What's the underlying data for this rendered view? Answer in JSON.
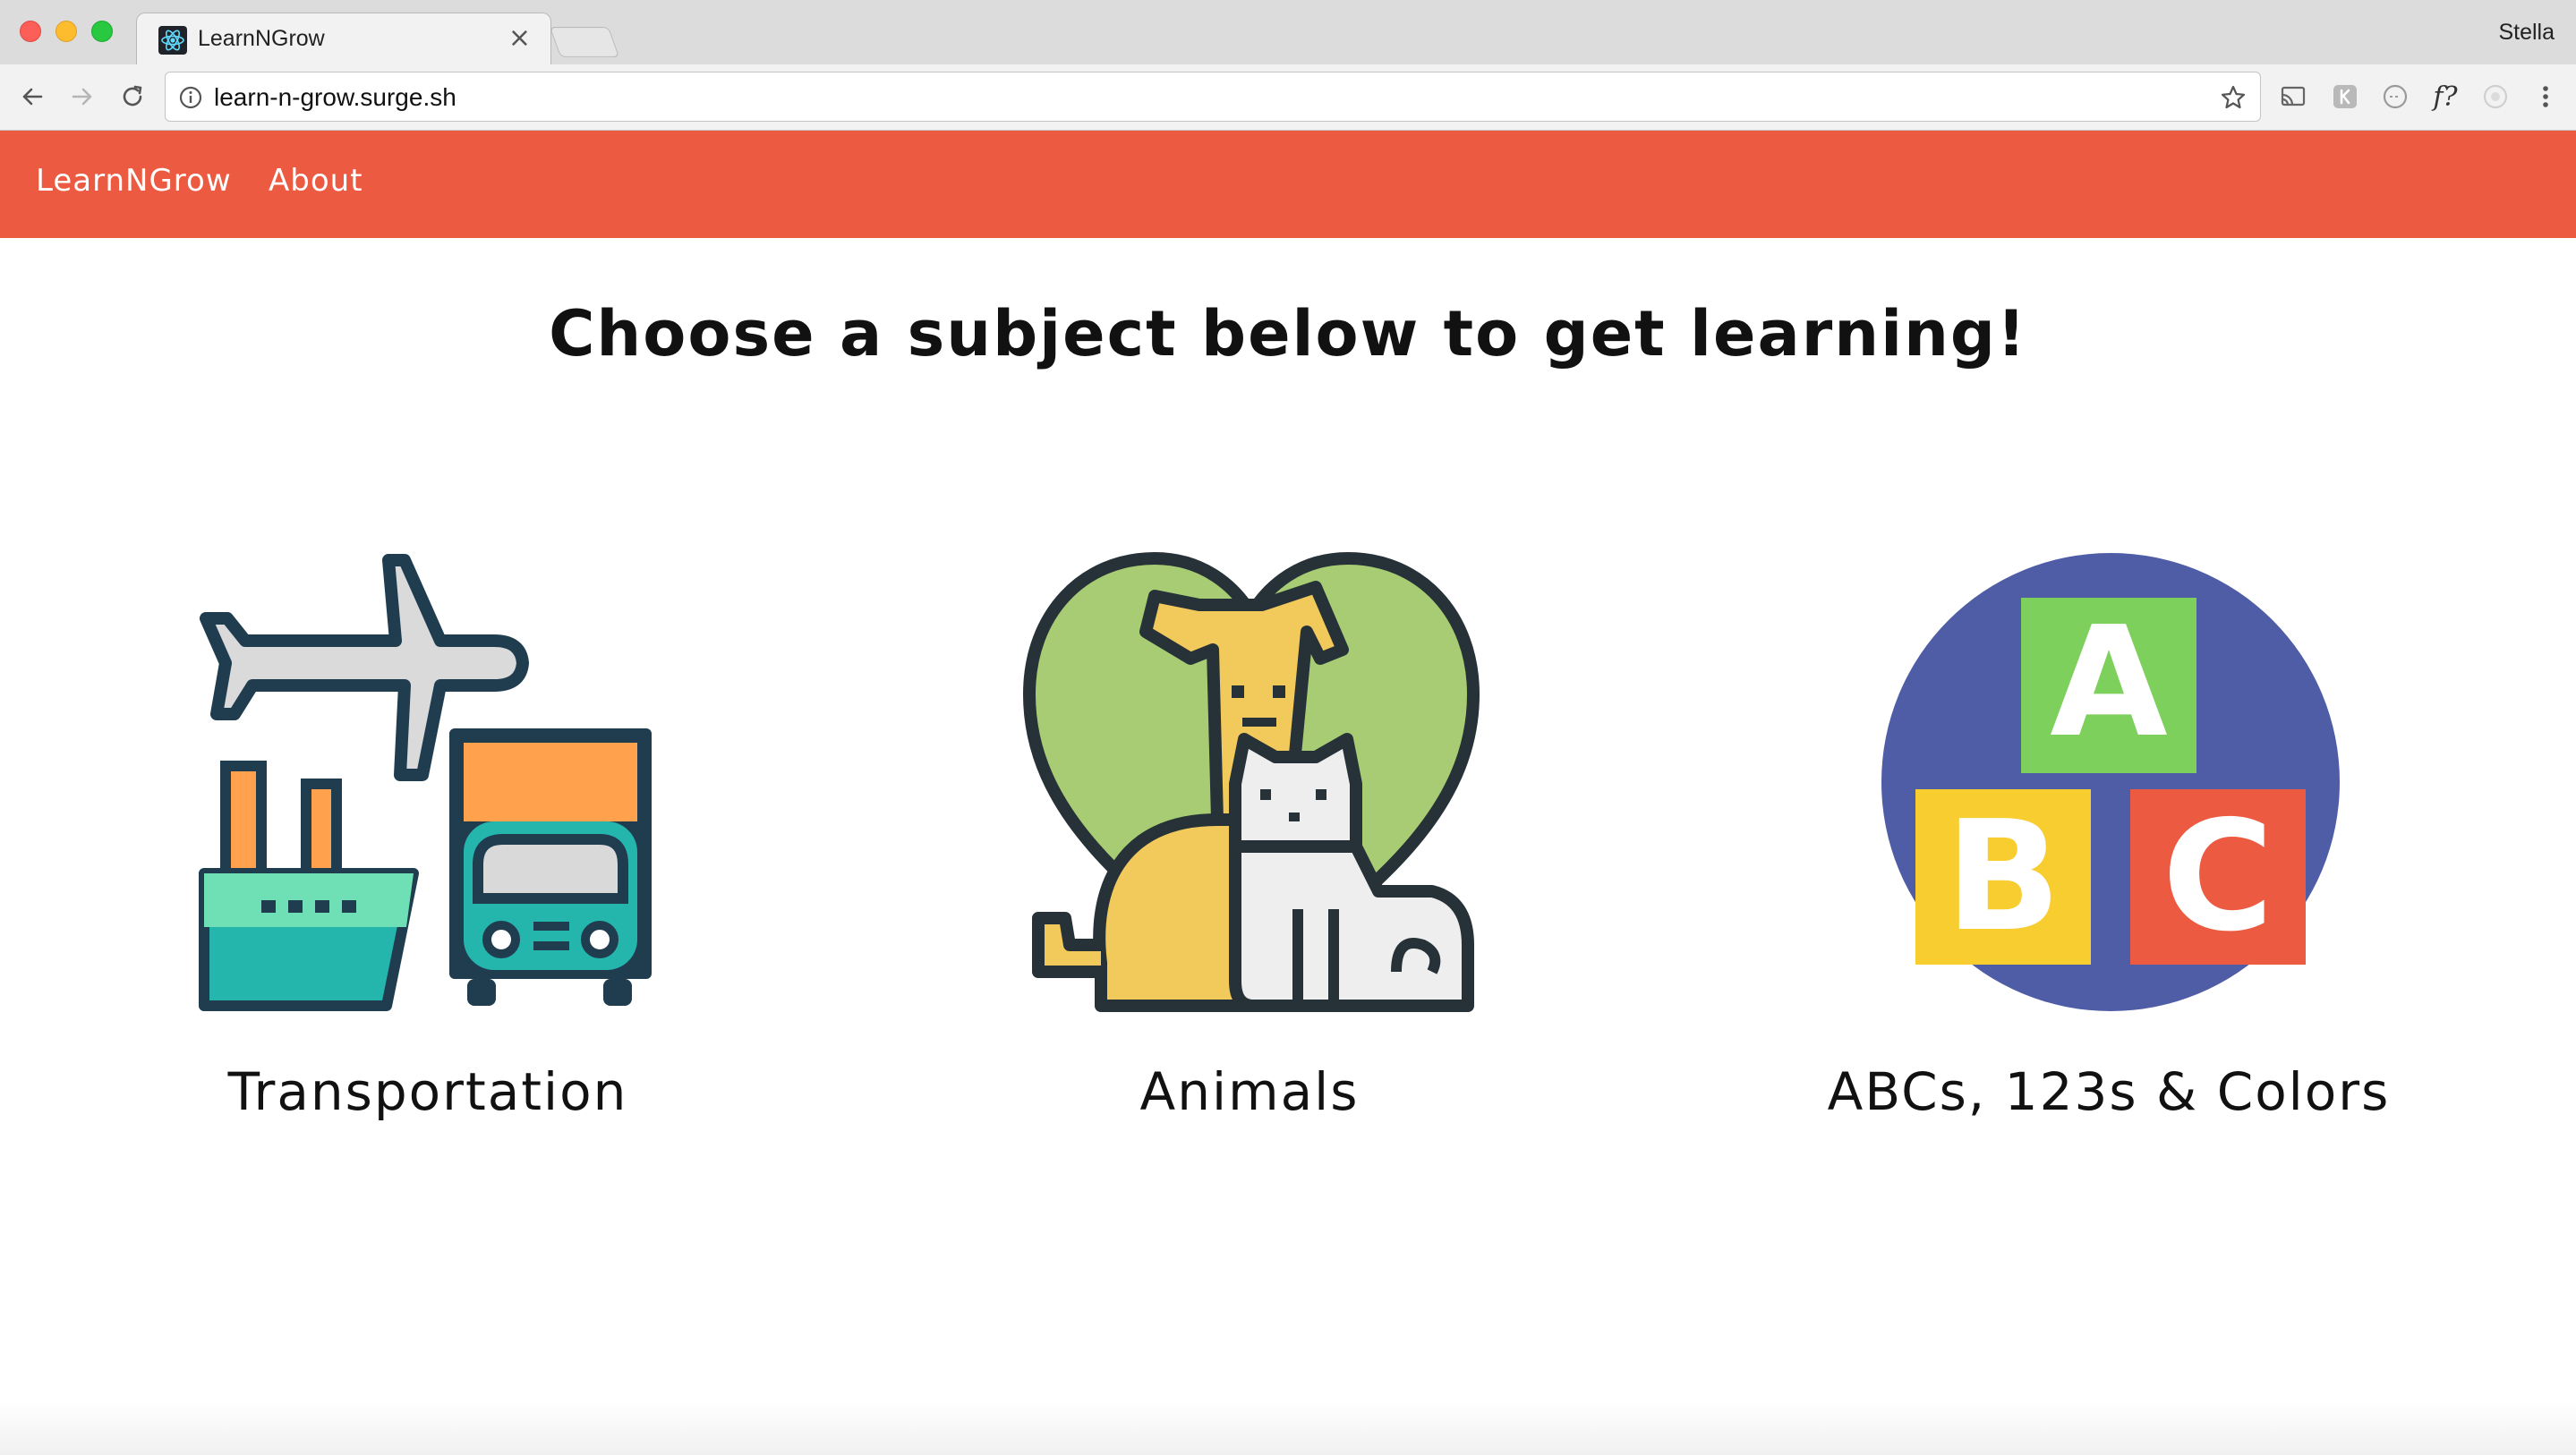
{
  "browser": {
    "tab_title": "LearnNGrow",
    "tab_close": "×",
    "profile_name": "Stella",
    "url": "learn-n-grow.surge.sh",
    "ext_f_label": "f?"
  },
  "site": {
    "brand": "LearnNGrow",
    "nav_about": "About",
    "headline": "Choose a subject below to get learning!"
  },
  "subjects": [
    {
      "label": "Transportation",
      "icon": "transportation-icon"
    },
    {
      "label": "Animals",
      "icon": "animals-icon"
    },
    {
      "label": "ABCs, 123s & Colors",
      "icon": "abc-blocks-icon"
    }
  ],
  "abc_blocks": {
    "a": "A",
    "b": "B",
    "c": "C"
  },
  "colors": {
    "nav_bg": "#ec5b41",
    "abc_circle": "#4f5ca6",
    "block_a": "#7ed05c",
    "block_b": "#f7cd2f",
    "block_c": "#ec5b41"
  }
}
